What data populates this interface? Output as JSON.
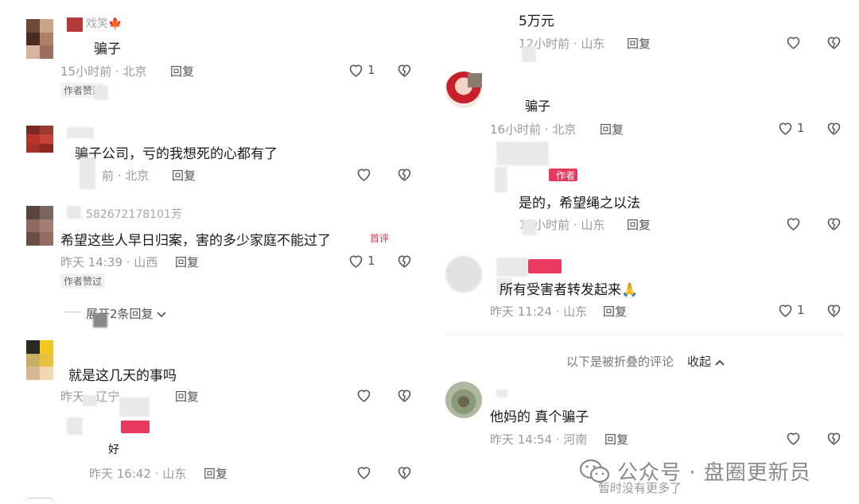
{
  "left": {
    "c1": {
      "name": "戏笑🍁",
      "text": "骗子",
      "meta": "15小时前 · 北京",
      "reply": "回复",
      "likes": "1",
      "badge": "作者赞过"
    },
    "c2": {
      "text": "骗子公司，亏的我想死的心都有了",
      "meta": "前 · 北京",
      "reply": "回复"
    },
    "c3": {
      "name": "582672178101芳",
      "text": "希望这些人早日归案，害的多少家庭不能过了",
      "tag": "首评",
      "meta": "昨天 14:39 · 山西",
      "reply": "回复",
      "likes": "1",
      "badge": "作者赞过",
      "expand": "展开2条回复"
    },
    "c4": {
      "text": "就是这几天的事吗",
      "meta": "昨天 · 辽宁",
      "reply": "回复"
    },
    "c5": {
      "text": "好",
      "meta": "昨天 16:42 · 山东",
      "reply": "回复"
    }
  },
  "right": {
    "c1": {
      "text": "5万元",
      "meta": "12小时前 · 山东",
      "reply": "回复"
    },
    "c2": {
      "text": "骗子",
      "meta": "16小时前 · 北京",
      "reply": "回复",
      "likes": "1"
    },
    "c3": {
      "tag": "作者",
      "text": "是的，希望绳之以法",
      "meta": "12小时前 · 山东",
      "reply": "回复"
    },
    "c4": {
      "text": "所有受害者转发起来🙏",
      "meta": "昨天 11:24 · 山东",
      "reply": "回复",
      "likes": "1"
    },
    "fold": {
      "label": "以下是被折叠的评论",
      "action": "收起"
    },
    "c5": {
      "text": "他妈的 真个骗子",
      "meta": "昨天 14:54 · 河南",
      "reply": "回复"
    },
    "end": "暂时没有更多了"
  },
  "watermark": "公众号 · 盘圈更新员",
  "colors": {
    "accent_red": "#e0314b",
    "meta_gray": "#9a9a9a"
  }
}
